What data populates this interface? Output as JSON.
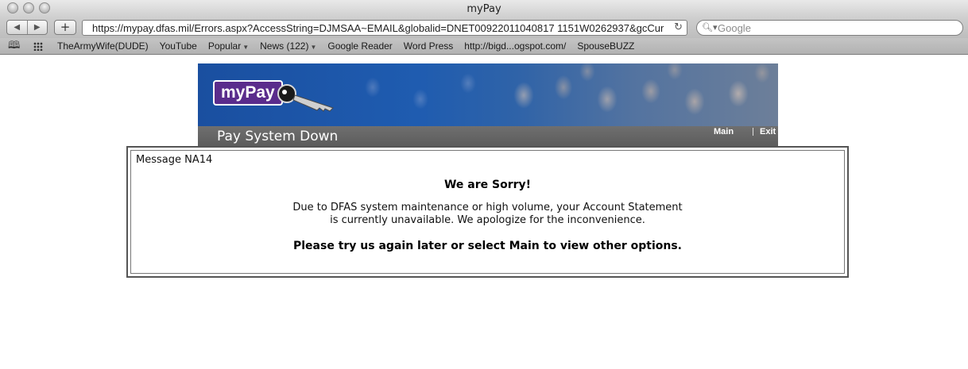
{
  "window": {
    "title": "myPay"
  },
  "toolbar": {
    "back_icon": "back-arrow-icon",
    "forward_icon": "forward-arrow-icon",
    "add_label": "+",
    "url": "https://mypay.dfas.mil/Errors.aspx?AccessString=DJMSAA~EMAIL&globalid=DNET00922011040817 1151W0262937&gcCur",
    "search_placeholder": "Google"
  },
  "bookmarks": [
    {
      "label": "TheArmyWife(DUDE)",
      "menu": false
    },
    {
      "label": "YouTube",
      "menu": false
    },
    {
      "label": "Popular",
      "menu": true
    },
    {
      "label": "News (122)",
      "menu": true
    },
    {
      "label": "Google Reader",
      "menu": false
    },
    {
      "label": "Word Press",
      "menu": false
    },
    {
      "label": "http://bigd...ogspot.com/",
      "menu": false
    },
    {
      "label": "SpouseBUZZ",
      "menu": false
    }
  ],
  "site": {
    "logo_text": "myPay",
    "page_title": "Pay System Down",
    "nav": {
      "main": "Main",
      "exit": "Exit"
    },
    "brand_color": "#5a2c8c"
  },
  "message": {
    "code": "Message NA14",
    "heading": "We are Sorry!",
    "line1": "Due to DFAS system maintenance or high volume, your Account Statement",
    "line2": "is currently unavailable. We apologize for the inconvenience.",
    "footer": "Please try us again later or select Main to view other options."
  }
}
